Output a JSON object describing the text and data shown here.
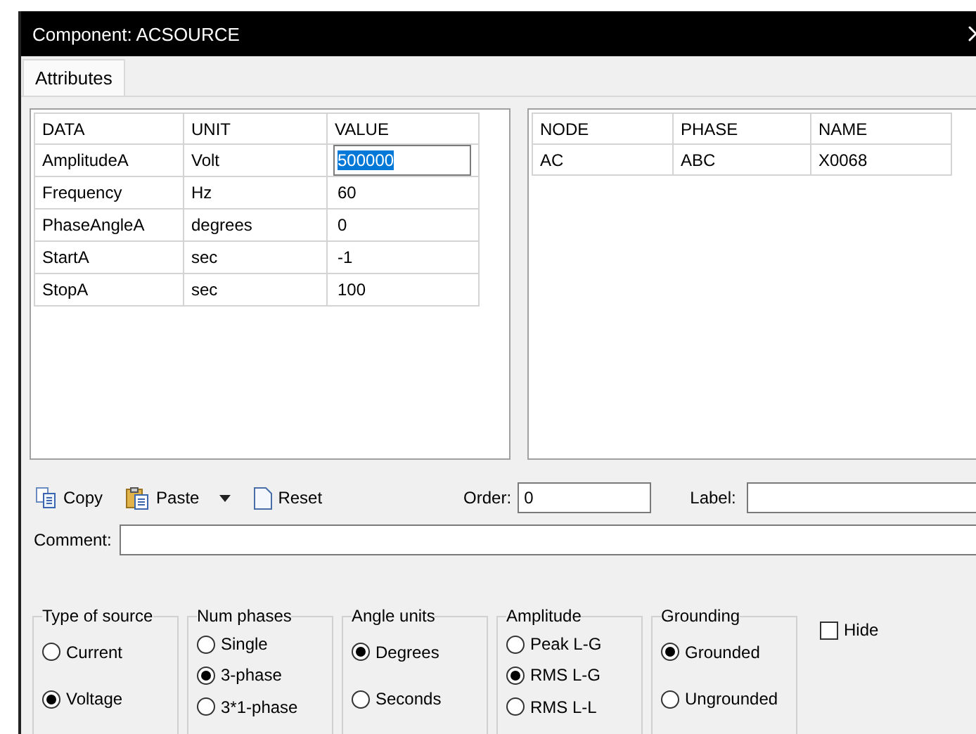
{
  "window": {
    "title": "Component: ACSOURCE"
  },
  "tabs": [
    {
      "label": "Attributes",
      "selected": true
    }
  ],
  "data_table": {
    "columns": [
      "DATA",
      "UNIT",
      "VALUE"
    ],
    "rows": [
      {
        "cells": [
          "AmplitudeA",
          "Volt",
          "500000"
        ],
        "editing": true
      },
      {
        "cells": [
          "Frequency",
          "Hz",
          "60"
        ],
        "editing": false
      },
      {
        "cells": [
          "PhaseAngleA",
          "degrees",
          "0"
        ],
        "editing": false
      },
      {
        "cells": [
          "StartA",
          "sec",
          "-1"
        ],
        "editing": false
      },
      {
        "cells": [
          "StopA",
          "sec",
          "100"
        ],
        "editing": false
      }
    ]
  },
  "node_table": {
    "columns": [
      "NODE",
      "PHASE",
      "NAME"
    ],
    "rows": [
      {
        "cells": [
          "AC",
          "ABC",
          "X0068"
        ]
      }
    ]
  },
  "toolbar": [
    {
      "label": "Copy",
      "kind": "copy",
      "dropdown": false
    },
    {
      "label": "Paste",
      "kind": "paste",
      "dropdown": true
    },
    {
      "label": "Reset",
      "kind": "reset",
      "dropdown": false
    }
  ],
  "order": {
    "label": "Order:",
    "value": "0"
  },
  "label_field": {
    "label": "Label:"
  },
  "comment": {
    "label": "Comment:"
  },
  "groups": [
    {
      "title": "Type of source",
      "options": [
        {
          "label": "Current",
          "selected": false
        },
        {
          "label": "Voltage",
          "selected": true
        }
      ]
    },
    {
      "title": "Num phases",
      "options": [
        {
          "label": "Single",
          "selected": false
        },
        {
          "label": "3-phase",
          "selected": true
        },
        {
          "label": "3*1-phase",
          "selected": false
        }
      ]
    },
    {
      "title": "Angle units",
      "options": [
        {
          "label": "Degrees",
          "selected": true
        },
        {
          "label": "Seconds",
          "selected": false
        }
      ]
    },
    {
      "title": "Amplitude",
      "options": [
        {
          "label": "Peak L-G",
          "selected": false
        },
        {
          "label": "RMS L-G",
          "selected": true
        },
        {
          "label": "RMS L-L",
          "selected": false
        }
      ]
    },
    {
      "title": "Grounding",
      "options": [
        {
          "label": "Grounded",
          "selected": true
        },
        {
          "label": "Ungrounded",
          "selected": false
        }
      ]
    }
  ],
  "hide": {
    "label": "Hide",
    "checked": false
  }
}
